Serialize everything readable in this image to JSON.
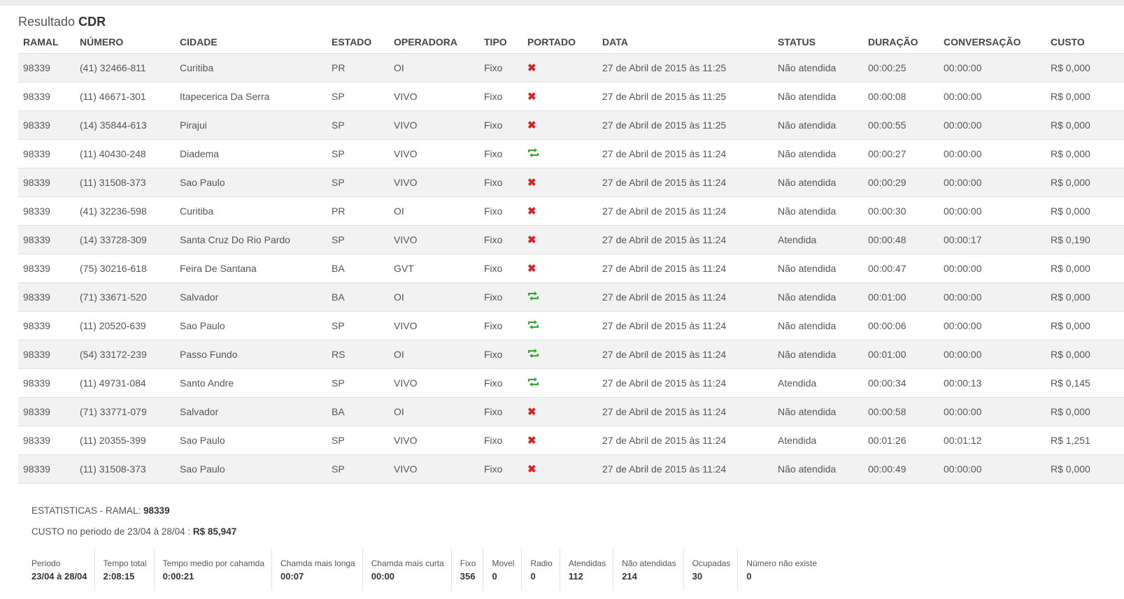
{
  "header": {
    "title_prefix": "Resultado",
    "title_bold": "CDR"
  },
  "columns": [
    "RAMAL",
    "NÚMERO",
    "CIDADE",
    "ESTADO",
    "OPERADORA",
    "TIPO",
    "PORTADO",
    "DATA",
    "STATUS",
    "DURAÇÃO",
    "CONVERSAÇÃO",
    "CUSTO"
  ],
  "rows": [
    {
      "ramal": "98339",
      "numero": "(41) 32466-811",
      "cidade": "Curitiba",
      "estado": "PR",
      "operadora": "OI",
      "tipo": "Fixo",
      "portado": "no",
      "data": "27 de Abril de 2015 às 11:25",
      "status": "Não atendida",
      "duracao": "00:00:25",
      "conversacao": "00:00:00",
      "custo": "R$ 0,000"
    },
    {
      "ramal": "98339",
      "numero": "(11) 46671-301",
      "cidade": "Itapecerica Da Serra",
      "estado": "SP",
      "operadora": "VIVO",
      "tipo": "Fixo",
      "portado": "no",
      "data": "27 de Abril de 2015 às 11:25",
      "status": "Não atendida",
      "duracao": "00:00:08",
      "conversacao": "00:00:00",
      "custo": "R$ 0,000"
    },
    {
      "ramal": "98339",
      "numero": "(14) 35844-613",
      "cidade": "Pirajui",
      "estado": "SP",
      "operadora": "VIVO",
      "tipo": "Fixo",
      "portado": "no",
      "data": "27 de Abril de 2015 às 11:25",
      "status": "Não atendida",
      "duracao": "00:00:55",
      "conversacao": "00:00:00",
      "custo": "R$ 0,000"
    },
    {
      "ramal": "98339",
      "numero": "(11) 40430-248",
      "cidade": "Diadema",
      "estado": "SP",
      "operadora": "VIVO",
      "tipo": "Fixo",
      "portado": "yes",
      "data": "27 de Abril de 2015 às 11:24",
      "status": "Não atendida",
      "duracao": "00:00:27",
      "conversacao": "00:00:00",
      "custo": "R$ 0,000"
    },
    {
      "ramal": "98339",
      "numero": "(11) 31508-373",
      "cidade": "Sao Paulo",
      "estado": "SP",
      "operadora": "VIVO",
      "tipo": "Fixo",
      "portado": "no",
      "data": "27 de Abril de 2015 às 11:24",
      "status": "Não atendida",
      "duracao": "00:00:29",
      "conversacao": "00:00:00",
      "custo": "R$ 0,000"
    },
    {
      "ramal": "98339",
      "numero": "(41) 32236-598",
      "cidade": "Curitiba",
      "estado": "PR",
      "operadora": "OI",
      "tipo": "Fixo",
      "portado": "no",
      "data": "27 de Abril de 2015 às 11:24",
      "status": "Não atendida",
      "duracao": "00:00:30",
      "conversacao": "00:00:00",
      "custo": "R$ 0,000"
    },
    {
      "ramal": "98339",
      "numero": "(14) 33728-309",
      "cidade": "Santa Cruz Do Rio Pardo",
      "estado": "SP",
      "operadora": "VIVO",
      "tipo": "Fixo",
      "portado": "no",
      "data": "27 de Abril de 2015 às 11:24",
      "status": "Atendida",
      "duracao": "00:00:48",
      "conversacao": "00:00:17",
      "custo": "R$ 0,190"
    },
    {
      "ramal": "98339",
      "numero": "(75) 30216-618",
      "cidade": "Feira De Santana",
      "estado": "BA",
      "operadora": "GVT",
      "tipo": "Fixo",
      "portado": "no",
      "data": "27 de Abril de 2015 às 11:24",
      "status": "Não atendida",
      "duracao": "00:00:47",
      "conversacao": "00:00:00",
      "custo": "R$ 0,000"
    },
    {
      "ramal": "98339",
      "numero": "(71) 33671-520",
      "cidade": "Salvador",
      "estado": "BA",
      "operadora": "OI",
      "tipo": "Fixo",
      "portado": "yes",
      "data": "27 de Abril de 2015 às 11:24",
      "status": "Não atendida",
      "duracao": "00:01:00",
      "conversacao": "00:00:00",
      "custo": "R$ 0,000"
    },
    {
      "ramal": "98339",
      "numero": "(11) 20520-639",
      "cidade": "Sao Paulo",
      "estado": "SP",
      "operadora": "VIVO",
      "tipo": "Fixo",
      "portado": "yes",
      "data": "27 de Abril de 2015 às 11:24",
      "status": "Não atendida",
      "duracao": "00:00:06",
      "conversacao": "00:00:00",
      "custo": "R$ 0,000"
    },
    {
      "ramal": "98339",
      "numero": "(54) 33172-239",
      "cidade": "Passo Fundo",
      "estado": "RS",
      "operadora": "OI",
      "tipo": "Fixo",
      "portado": "yes",
      "data": "27 de Abril de 2015 às 11:24",
      "status": "Não atendida",
      "duracao": "00:01:00",
      "conversacao": "00:00:00",
      "custo": "R$ 0,000"
    },
    {
      "ramal": "98339",
      "numero": "(11) 49731-084",
      "cidade": "Santo Andre",
      "estado": "SP",
      "operadora": "VIVO",
      "tipo": "Fixo",
      "portado": "yes",
      "data": "27 de Abril de 2015 às 11:24",
      "status": "Atendida",
      "duracao": "00:00:34",
      "conversacao": "00:00:13",
      "custo": "R$ 0,145"
    },
    {
      "ramal": "98339",
      "numero": "(71) 33771-079",
      "cidade": "Salvador",
      "estado": "BA",
      "operadora": "OI",
      "tipo": "Fixo",
      "portado": "no",
      "data": "27 de Abril de 2015 às 11:24",
      "status": "Não atendida",
      "duracao": "00:00:58",
      "conversacao": "00:00:00",
      "custo": "R$ 0,000"
    },
    {
      "ramal": "98339",
      "numero": "(11) 20355-399",
      "cidade": "Sao Paulo",
      "estado": "SP",
      "operadora": "VIVO",
      "tipo": "Fixo",
      "portado": "no",
      "data": "27 de Abril de 2015 às 11:24",
      "status": "Atendida",
      "duracao": "00:01:26",
      "conversacao": "00:01:12",
      "custo": "R$ 1,251"
    },
    {
      "ramal": "98339",
      "numero": "(11) 31508-373",
      "cidade": "Sao Paulo",
      "estado": "SP",
      "operadora": "VIVO",
      "tipo": "Fixo",
      "portado": "no",
      "data": "27 de Abril de 2015 às 11:24",
      "status": "Não atendida",
      "duracao": "00:00:49",
      "conversacao": "00:00:00",
      "custo": "R$ 0,000"
    }
  ],
  "icons": {
    "not_ported": "x-icon",
    "ported": "ported-arrows-icon"
  },
  "colors": {
    "not_ported": "#e02020",
    "ported": "#3aa53a"
  },
  "stats": {
    "line1_prefix": "ESTATISTICAS - RAMAL: ",
    "line1_value": "98339",
    "line2_prefix": "CUSTO no periodo de 23/04 à 28/04 : ",
    "line2_value": "R$ 85,947",
    "boxes": [
      {
        "label": "Periodo",
        "value": "23/04 à 28/04"
      },
      {
        "label": "Tempo total",
        "value": "2:08:15"
      },
      {
        "label": "Tempo medio por cahamda",
        "value": "0:00:21"
      },
      {
        "label": "Chamda mais longa",
        "value": "00:07"
      },
      {
        "label": "Chamda mais curta",
        "value": "00:00"
      },
      {
        "label": "Fixo",
        "value": "356"
      },
      {
        "label": "Movel",
        "value": "0"
      },
      {
        "label": "Radio",
        "value": "0"
      },
      {
        "label": "Atendidas",
        "value": "112"
      },
      {
        "label": "Não atendidas",
        "value": "214"
      },
      {
        "label": "Ocupadas",
        "value": "30"
      },
      {
        "label": "Número não existe",
        "value": "0"
      }
    ]
  }
}
